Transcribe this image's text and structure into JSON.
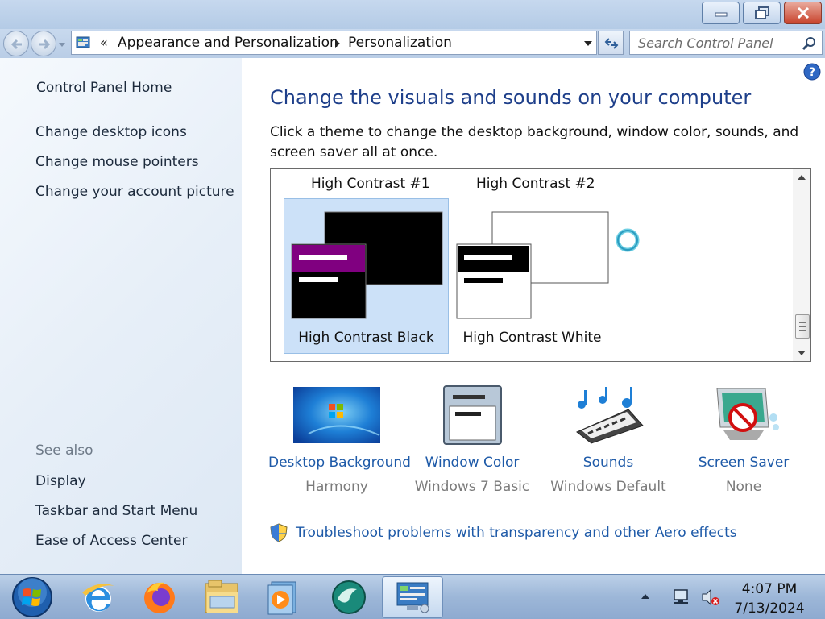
{
  "window": {
    "minimize_label": "",
    "maximize_label": "",
    "close_label": ""
  },
  "address_bar": {
    "breadcrumbs": [
      "Appearance and Personalization",
      "Personalization"
    ],
    "search_placeholder": "Search Control Panel"
  },
  "sidebar": {
    "home_link": "Control Panel Home",
    "links": [
      "Change desktop icons",
      "Change mouse pointers",
      "Change your account picture"
    ],
    "see_also_label": "See also",
    "see_also_links": [
      "Display",
      "Taskbar and Start Menu",
      "Ease of Access Center"
    ]
  },
  "main": {
    "title": "Change the visuals and sounds on your computer",
    "description": "Click a theme to change the desktop background, window color, sounds, and screen saver all at once.",
    "theme_groups": [
      {
        "label": "High Contrast #1",
        "theme": "High Contrast Black",
        "selected": true
      },
      {
        "label": "High Contrast #2",
        "theme": "High Contrast White",
        "selected": false
      }
    ],
    "settings": [
      {
        "label": "Desktop Background",
        "value": "Harmony",
        "icon": "desktop-background-icon"
      },
      {
        "label": "Window Color",
        "value": "Windows 7 Basic",
        "icon": "window-color-icon"
      },
      {
        "label": "Sounds",
        "value": "Windows Default",
        "icon": "sounds-icon"
      },
      {
        "label": "Screen Saver",
        "value": "None",
        "icon": "screen-saver-icon"
      }
    ],
    "troubleshoot_link": "Troubleshoot problems with transparency and other Aero effects"
  },
  "taskbar": {
    "apps": [
      "internet-explorer-icon",
      "firefox-icon",
      "file-explorer-icon",
      "media-player-icon",
      "app-icon",
      "control-panel-icon"
    ],
    "clock_time": "4:07 PM",
    "clock_date": "7/13/2024"
  }
}
